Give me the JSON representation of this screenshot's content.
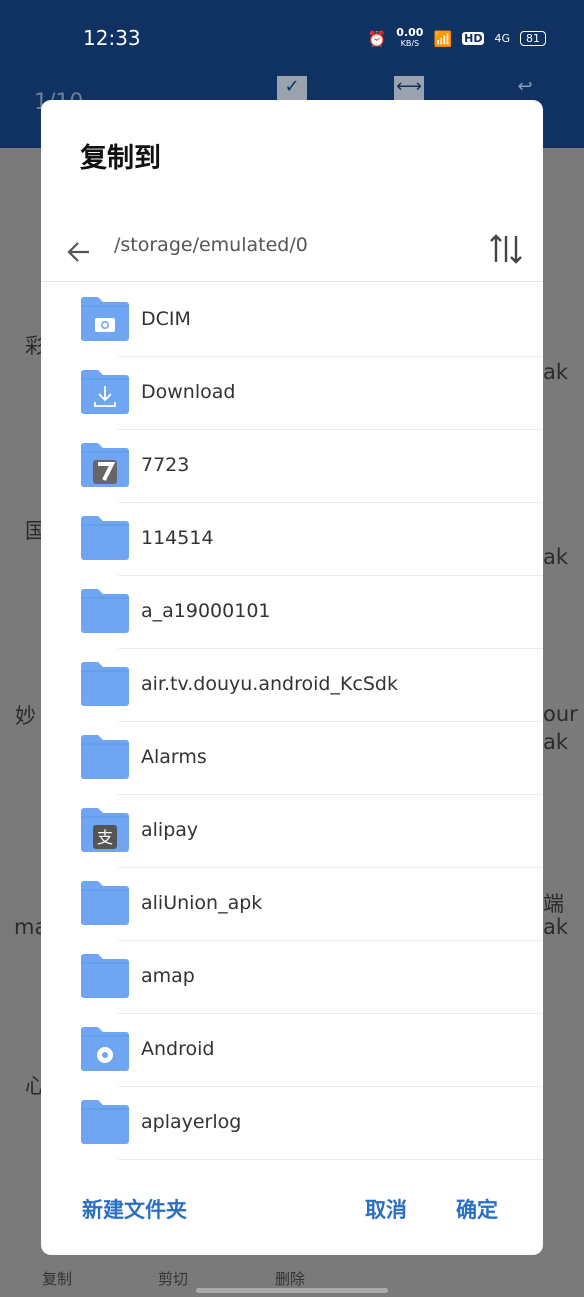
{
  "status_bar": {
    "time": "12:33",
    "net_speed": "0.00",
    "net_unit": "KB/S",
    "hd": "HD",
    "network": "4G",
    "battery": "81"
  },
  "background": {
    "counter": "1/10",
    "left_fragments": [
      "彩",
      "国",
      "妙",
      "ma",
      "心"
    ],
    "right_fragments": [
      "ak",
      "ak",
      "our",
      "ak",
      "端",
      "ak"
    ],
    "bottom_bar": [
      "复制",
      "剪切",
      "删除"
    ]
  },
  "dialog": {
    "title": "复制到",
    "path": "/storage/emulated/0",
    "folders": [
      {
        "name": "DCIM",
        "badge": "camera"
      },
      {
        "name": "Download",
        "badge": "download"
      },
      {
        "name": "7723",
        "badge": "app-7723"
      },
      {
        "name": "114514",
        "badge": ""
      },
      {
        "name": "a_a19000101",
        "badge": ""
      },
      {
        "name": "air.tv.douyu.android_KcSdk",
        "badge": ""
      },
      {
        "name": "Alarms",
        "badge": ""
      },
      {
        "name": "alipay",
        "badge": "alipay"
      },
      {
        "name": "aliUnion_apk",
        "badge": ""
      },
      {
        "name": "amap",
        "badge": ""
      },
      {
        "name": "Android",
        "badge": "gear"
      },
      {
        "name": "aplayerlog",
        "badge": ""
      }
    ],
    "new_folder": "新建文件夹",
    "cancel": "取消",
    "confirm": "确定"
  },
  "colors": {
    "accent": "#2b6fc2",
    "folder": "#6fa5f2",
    "topbar": "#0f3262"
  }
}
